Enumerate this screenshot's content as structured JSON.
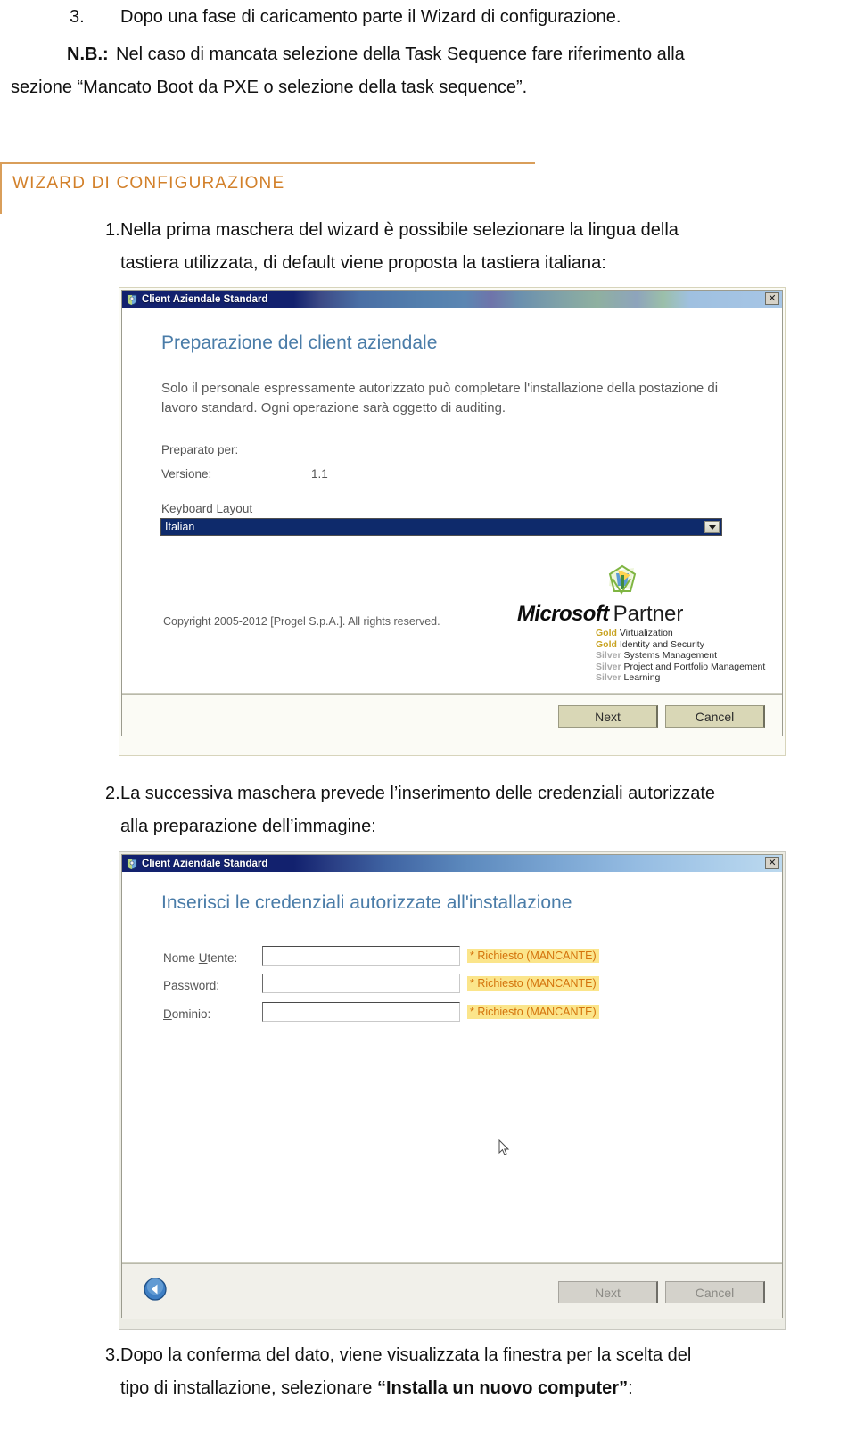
{
  "document": {
    "item3_top": {
      "number": "3.",
      "text": "Dopo una fase di caricamento parte il Wizard di configurazione."
    },
    "note": {
      "label": "N.B.:",
      "line1": "Nel caso di mancata selezione della Task Sequence fare riferimento alla",
      "line2": "sezione “Mancato Boot da PXE o selezione della task sequence”."
    },
    "section_heading": "WIZARD DI CONFIGURAZIONE",
    "item1": {
      "number": "1.",
      "line1": "Nella  prima  maschera  del  wizard  è  possibile  selezionare  la  lingua  della",
      "line2": "tastiera utilizzata, di default viene proposta la tastiera italiana:"
    },
    "item2": {
      "number": "2.",
      "line1": "La successiva maschera prevede l’inserimento delle credenziali autorizzate",
      "line2": "alla preparazione dell’immagine:"
    },
    "item3_bottom": {
      "number": "3.",
      "line1": "Dopo la conferma del dato, viene visualizzata la finestra per la scelta del",
      "line2_pre": "tipo di installazione, selezionare ",
      "line2_bold": "“Installa un nuovo computer”",
      "line2_post": ":"
    }
  },
  "dialog1": {
    "titlebar": {
      "title": "Client Aziendale Standard",
      "icon": "app-shield-icon",
      "close_label": "✕"
    },
    "heading": "Preparazione del client aziendale",
    "body_text_line1": "Solo il personale espressamente autorizzato può completare l'installazione della postazione di",
    "body_text_line2": "lavoro standard. Ogni operazione sarà oggetto di auditing.",
    "fields": [
      {
        "label": "Preparato per:",
        "value": ""
      },
      {
        "label": "Versione:",
        "value": "1.1"
      }
    ],
    "keyboard": {
      "label": "Keyboard Layout",
      "selected": "Italian",
      "options": [
        "Italian"
      ]
    },
    "copyright": "Copyright 2005-2012 [Progel S.p.A.]. All rights reserved.",
    "partner": {
      "brand": "Microsoft",
      "program": "Partner",
      "competencies": [
        {
          "tier": "Gold",
          "name": "Virtualization"
        },
        {
          "tier": "Gold",
          "name": "Identity and Security"
        },
        {
          "tier": "Silver",
          "name": "Systems Management"
        },
        {
          "tier": "Silver",
          "name": "Project and Portfolio Management"
        },
        {
          "tier": "Silver",
          "name": "Learning"
        }
      ]
    },
    "buttons": {
      "next": "Next",
      "cancel": "Cancel"
    }
  },
  "dialog2": {
    "titlebar": {
      "title": "Client Aziendale Standard",
      "icon": "app-shield-icon",
      "close_label": "✕"
    },
    "heading": "Inserisci le credenziali autorizzate all'installazione",
    "rows": [
      {
        "label_pre": "Nome ",
        "label_key": "U",
        "label_post": "tente:",
        "value": "",
        "status": "* Richiesto (MANCANTE)"
      },
      {
        "label_pre": "",
        "label_key": "P",
        "label_post": "assword:",
        "value": "",
        "status": "* Richiesto (MANCANTE)"
      },
      {
        "label_pre": "",
        "label_key": "D",
        "label_post": "ominio:",
        "value": "",
        "status": "* Richiesto (MANCANTE)"
      }
    ],
    "back_button": "back-arrow-icon",
    "buttons": {
      "next": "Next",
      "cancel": "Cancel"
    }
  },
  "colors": {
    "heading_accent": "#d2802a",
    "dialog_heading": "#4a7ca8",
    "combo_background": "#0e2a6b",
    "required_text": "#d4740c",
    "required_highlight": "#fbe58b",
    "button_face": "#d9d7b6",
    "button_face_grey": "#d4d2cb"
  }
}
